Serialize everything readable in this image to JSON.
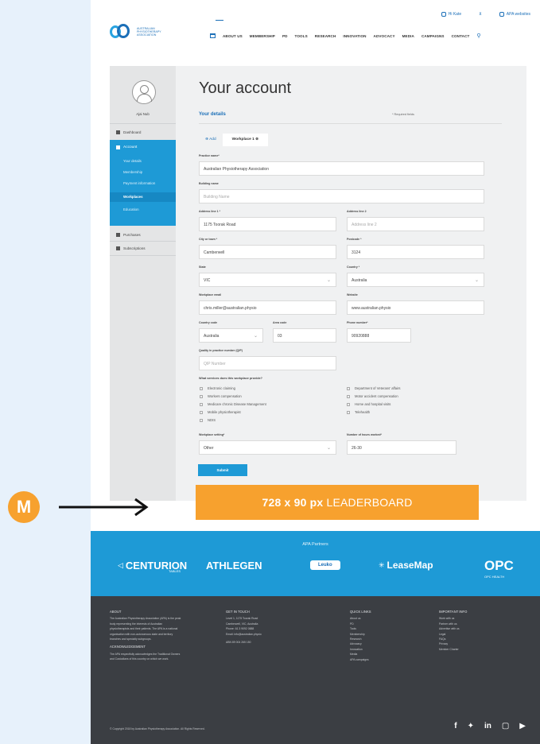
{
  "utility": {
    "profile": "Hi Kate",
    "websites": "APA websites"
  },
  "logo": {
    "text": "AUSTRALIAN PHYSIOTHERAPY ASSOCIATION"
  },
  "nav": {
    "items": [
      "ABOUT US",
      "MEMBERSHIP",
      "PD",
      "TOOLS",
      "RESEARCH",
      "INNOVATION",
      "ADVOCACY",
      "MEDIA",
      "CAMPAIGNS",
      "CONTACT"
    ]
  },
  "sidebar": {
    "user_name": "Ajai Nub",
    "dashboard": "Dashboard",
    "account": "Account",
    "account_items": [
      "Your details",
      "Membership",
      "Payment information",
      "Workplaces",
      "Education"
    ],
    "purchases": "Purchases",
    "subscriptions": "Subscriptions"
  },
  "main": {
    "title": "Your account",
    "section": "Your details",
    "required_note": "* Required fields",
    "tab_add": "Add",
    "tab_workplace": "Workplace 1"
  },
  "form": {
    "practice_name_label": "Practice name*",
    "practice_name": "Australian Physiotherapy Association",
    "building_label": "Building name",
    "building_placeholder": "Building Name",
    "addr1_label": "Address line 1 *",
    "addr1": "1175 Toorak Road",
    "addr2_label": "Address line 2",
    "addr2_placeholder": "Address line 2",
    "city_label": "City or town *",
    "city": "Camberwell",
    "postcode_label": "Postcode *",
    "postcode": "3124",
    "state_label": "State",
    "state": "VIC",
    "country_label": "Country *",
    "country": "Australia",
    "email_label": "Workplace email",
    "email": "chris.miller@australian.physio",
    "website_label": "Website",
    "website": "www.australian.physio",
    "country_code_label": "Country code",
    "country_code": "Australia",
    "area_code_label": "Area code",
    "area_code": "03",
    "phone_label": "Phone number*",
    "phone": "90920888",
    "qty_label": "Quality in practice number (QIP)",
    "qty_placeholder": "QIP Number",
    "services_label": "What services does this workplace provide?",
    "services_left": [
      "Electronic claiming",
      "Workers compensation",
      "Medicare chronic Disease Management",
      "Mobile physiotherapist",
      "NDIS"
    ],
    "services_right": [
      "Department of Veterans' affairs",
      "Motor accident compensation",
      "Home and hospital visits",
      "Telehealth"
    ],
    "setting_label": "Workplace setting*",
    "setting": "Other",
    "hours_label": "Number of hours worked*",
    "hours": "26-30",
    "submit": "Submit"
  },
  "leaderboard": {
    "size": "728 x 90 px",
    "word": "LEADERBOARD"
  },
  "annotation": {
    "badge": "M"
  },
  "partners": {
    "heading": "APA Partners",
    "logos": [
      "CENTURION",
      "ATHLEGEN",
      "Leuko",
      "LeaseMap",
      "OPC"
    ],
    "centurion_sub": "TABLES",
    "opc_sub": "OPC HEALTH"
  },
  "footer": {
    "about_heading": "ABOUT",
    "about_text": "The Australian Physiotherapy Association (APA) is the peak body representing the interests of Australian physiotherapists and their patients. The APA is a national organisation with non-autonomous state and territory branches and specialty subgroups.",
    "ack_heading": "ACKNOWLEDGEMENT",
    "ack_text": "The APA respectfully acknowledges the Traditional Owners and Custodians of this country on which we work.",
    "contact_heading": "GET IN TOUCH",
    "contact_items": [
      "Level 1, 1175 Toorak Road",
      "Camberwell, VIC, Australia",
      "Phone: 61 3 9092 0888",
      "Email: info@australian.physio"
    ],
    "contact_extra": "ABN 89 004 265 150",
    "quick_heading": "QUICK LINKS",
    "quick_items": [
      "About us",
      "PD",
      "Tools",
      "Membership",
      "Research",
      "Advocacy",
      "Innovation",
      "Media",
      "APA campaigns"
    ],
    "important_heading": "IMPORTANT INFO",
    "important_items": [
      "Work with us",
      "Partner with us",
      "Advertise with us",
      "Legal",
      "FAQs",
      "Privacy",
      "Member Charter"
    ],
    "copyright": "© Copyright 2018 by Australian Physiotherapy Association. All Rights Reserved.",
    "social": [
      "f",
      "tw",
      "in",
      "ig",
      "yt"
    ]
  }
}
